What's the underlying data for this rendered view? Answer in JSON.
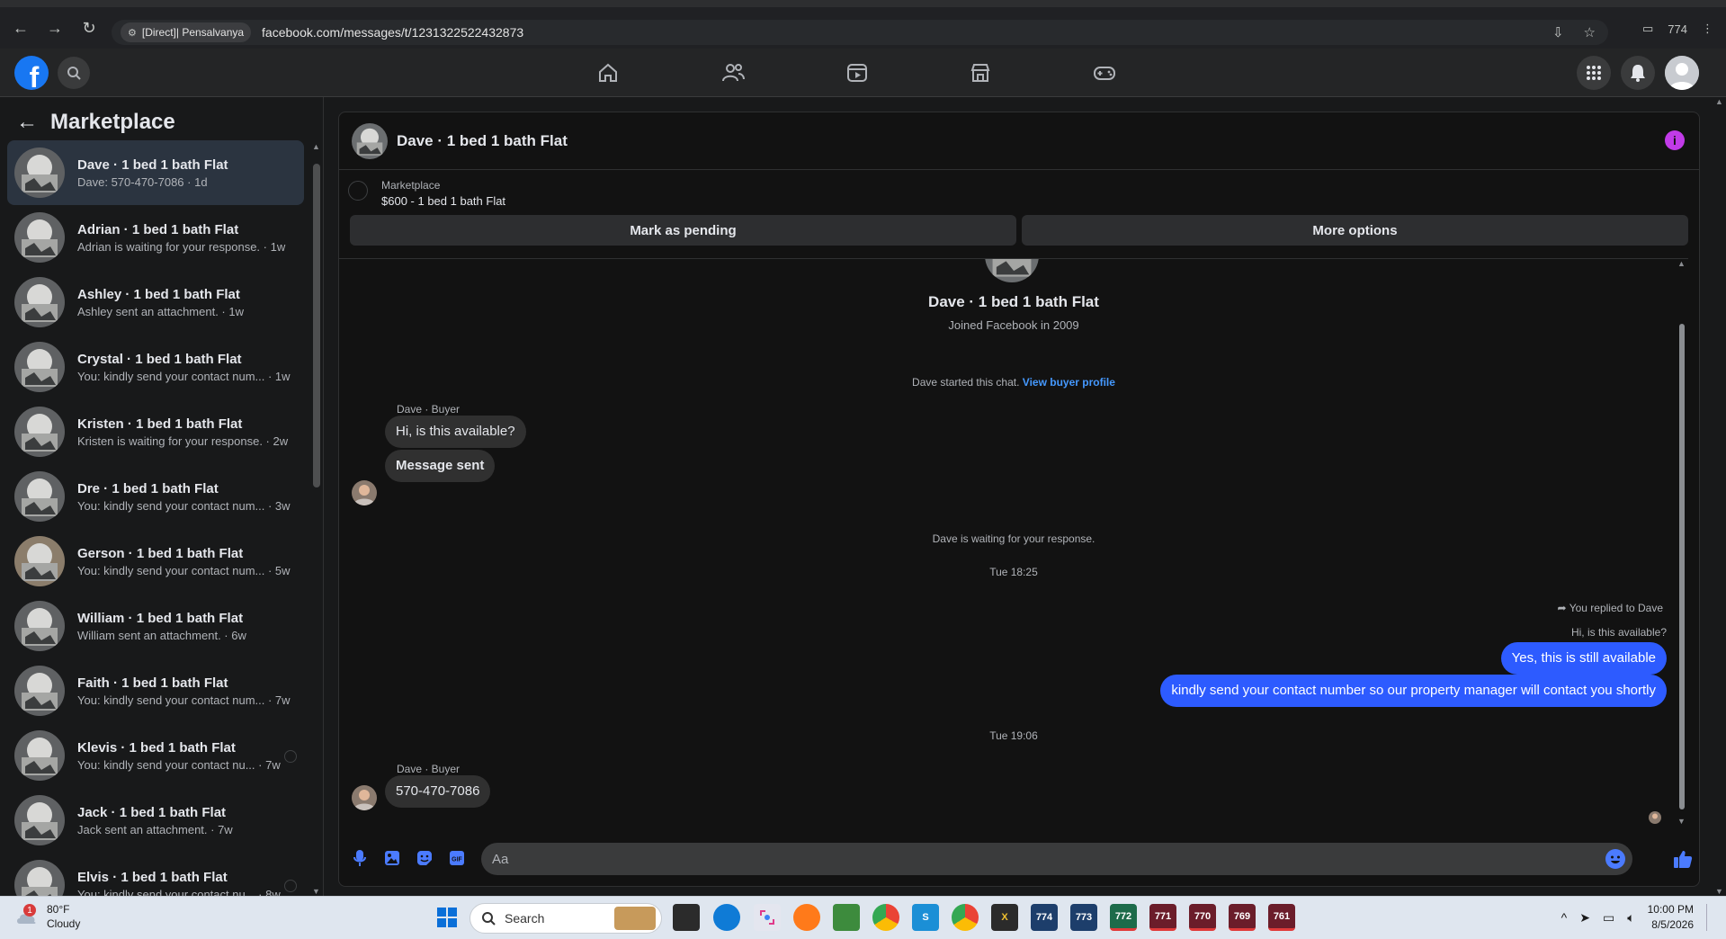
{
  "browser": {
    "site_chip": "[Direct]| Pensalvanya",
    "url": "facebook.com/messages/t/1231322522432873",
    "tab_count": "774"
  },
  "sidebar": {
    "title": "Marketplace",
    "conversations": [
      {
        "title": "Dave · 1 bed 1 bath Flat",
        "subtitle": "Dave: 570-470-7086 · 1d"
      },
      {
        "title": "Adrian · 1 bed 1 bath Flat",
        "subtitle": "Adrian is waiting for your response. · 1w"
      },
      {
        "title": "Ashley · 1 bed 1 bath Flat",
        "subtitle": "Ashley sent an attachment. · 1w"
      },
      {
        "title": "Crystal · 1 bed 1 bath Flat",
        "subtitle": "You: kindly send your contact num...  · 1w"
      },
      {
        "title": "Kristen · 1 bed 1 bath Flat",
        "subtitle": "Kristen is waiting for your response. · 2w"
      },
      {
        "title": "Dre · 1 bed 1 bath Flat",
        "subtitle": "You: kindly send your contact num... · 3w"
      },
      {
        "title": "Gerson · 1 bed 1 bath Flat",
        "subtitle": "You: kindly send your contact num... · 5w"
      },
      {
        "title": "William · 1 bed 1 bath Flat",
        "subtitle": "William sent an attachment. · 6w"
      },
      {
        "title": "Faith · 1 bed 1 bath Flat",
        "subtitle": "You: kindly send your contact num... · 7w"
      },
      {
        "title": "Klevis · 1 bed 1 bath Flat",
        "subtitle": "You: kindly send your contact nu... · 7w"
      },
      {
        "title": "Jack · 1 bed 1 bath Flat",
        "subtitle": "Jack sent an attachment. · 7w"
      },
      {
        "title": "Elvis · 1 bed 1 bath Flat",
        "subtitle": "You: kindly send your contact nu... · 8w"
      }
    ]
  },
  "chat": {
    "title": "Dave · 1 bed 1 bath Flat",
    "marketplace_label": "Marketplace",
    "listing": "$600 - 1 bed 1 bath Flat",
    "mark_pending": "Mark as pending",
    "more_options": "More options",
    "profile_name": "Dave · 1 bed 1 bath Flat",
    "joined": "Joined Facebook in 2009",
    "started_text": "Dave started this chat.",
    "view_buyer": "View buyer profile",
    "sender1": "Dave · Buyer",
    "msg1": "Hi, is this available?",
    "msg2": "Message sent",
    "waiting": "Dave is waiting for your response.",
    "time1": "Tue 18:25",
    "replied_to": "You replied to Dave",
    "quoted": "Hi, is this available?",
    "out1": "Yes, this is still available",
    "out2": "kindly send your contact number so our property manager will contact you shortly",
    "time2": "Tue 19:06",
    "sender2": "Dave · Buyer",
    "msg3": "570-470-7086",
    "composer_placeholder": "Aa"
  },
  "taskbar": {
    "temp": "80°F",
    "condition": "Cloudy",
    "weather_badge": "1",
    "search_label": "Search",
    "pinned_numbers": [
      "774",
      "773",
      "772",
      "771",
      "770",
      "769",
      "761"
    ],
    "time": "10:00 PM",
    "date": "8/5/2026"
  },
  "colors": {
    "fb_blue": "#1877f2",
    "outgoing_bubble": "#2d5bff",
    "info_purple": "#c13be8"
  }
}
